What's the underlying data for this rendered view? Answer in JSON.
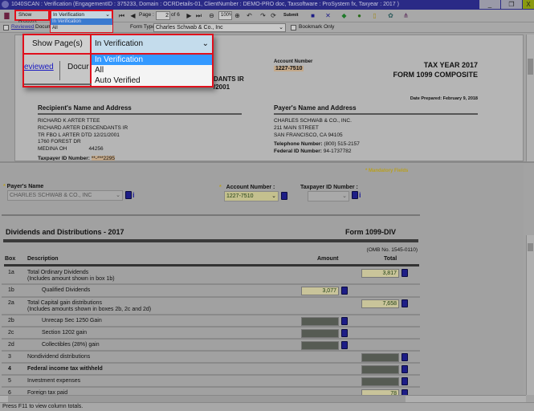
{
  "window": {
    "title": "1040SCAN : Verification (EngagementID : 375233, Domain : OCRDetails-01, ClientNumber : DEMO-PRO doc, Taxsoftware : ProSystem fx, Taxyear : 2017 )",
    "minimize": "_",
    "restore": "❐",
    "close": "X"
  },
  "toolbar": {
    "show_pages_label": "Show Page(s)",
    "show_pages_value": "In Verification",
    "show_pages_options": [
      "In Verification",
      "All",
      "Auto Verified"
    ],
    "page_label": "Page :",
    "page_value": "2",
    "page_of": "of 6",
    "zoom_value": "100%",
    "submit_label": "Submit"
  },
  "toolbar2": {
    "reviewed_link": "Reviewed",
    "document_tab": "Docum",
    "form_type_label": "Form Type",
    "form_type_value": "Charles Schwab & Co., Inc",
    "bookmark_label": "Bookmark Only"
  },
  "callout": {
    "show_pages_label": "Show Page(s)",
    "value": "In Verification",
    "options": [
      "In Verification",
      "All",
      "Auto Verified"
    ],
    "reviewed_link": "eviewed",
    "document_tab": "Docur"
  },
  "document": {
    "account_number_label": "Account Number",
    "account_number": "1227-7510",
    "tax_year": "TAX YEAR 2017",
    "form_title": "FORM 1099 COMPOSITE",
    "date_prepared_label": "Date Prepared:",
    "date_prepared": "February 9, 2018",
    "hidden_1": "DANTS IR",
    "hidden_2": "/2001",
    "recipient_heading": "Recipient's Name and Address",
    "recipient_lines": [
      "RICHARD K ARTER TTEE",
      "RICHARD ARTER DESCENDANTS IR",
      "TR FBO L ARTER DTD 12/21/2001",
      "1760 FOREST DR",
      "MEDINA OH"
    ],
    "recipient_zip": "44256",
    "taxpayer_id_label": "Taxpayer ID Number:",
    "taxpayer_id": "**-***2295",
    "payer_heading": "Payer's Name and Address",
    "payer_lines": [
      "CHARLES SCHWAB & CO., INC.",
      "211 MAIN STREET",
      "SAN FRANCISCO, CA 94105"
    ],
    "telephone_label": "Telephone Number:",
    "telephone": "(800) 515-2157",
    "federal_id_label": "Federal ID Number:",
    "federal_id": "94-1737782"
  },
  "form": {
    "mandatory": "* Mandatory Fields",
    "payer_name_label": "Payer's Name",
    "payer_name_value": "CHARLES SCHWAB & CO., INC",
    "account_number_label": "Account Number :",
    "account_number_value": "1227-7510",
    "taxpayer_id_label": "Taxpayer ID Number :",
    "taxpayer_id_value": "",
    "info": "i",
    "section_title": "Dividends and Distributions - 2017",
    "form_name": "Form 1099-DIV",
    "omb": "(OMB No. 1545-0110)",
    "col_box": "Box",
    "col_description": "Description",
    "col_amount": "Amount",
    "col_total": "Total",
    "rows": [
      {
        "box": "1a",
        "desc": "Total Ordinary Dividends",
        "desc2": "(Includes amount shown in box 1b)",
        "col": "total",
        "value": "3,817",
        "filled": true
      },
      {
        "box": "1b",
        "desc": "Qualified Dividends",
        "indent": true,
        "col": "amount",
        "value": "3,077",
        "filled": true
      },
      {
        "box": "2a",
        "desc": "Total Capital gain distributions",
        "desc2": "(Includes amounts shown in boxes 2b, 2c and 2d)",
        "col": "total",
        "value": "7,658",
        "filled": true
      },
      {
        "box": "2b",
        "desc": "Unrecap Sec 1250 Gain",
        "indent": true,
        "col": "amount",
        "value": "",
        "filled": false
      },
      {
        "box": "2c",
        "desc": "Section 1202 gain",
        "indent": true,
        "col": "amount",
        "value": "",
        "filled": false
      },
      {
        "box": "2d",
        "desc": "Collectibles (28%) gain",
        "indent": true,
        "col": "amount",
        "value": "",
        "filled": false
      },
      {
        "box": "3",
        "desc": "Nondividend distributions",
        "col": "total",
        "value": "",
        "filled": false
      },
      {
        "box": "4",
        "desc": "Federal income tax withheld",
        "bold": true,
        "col": "total",
        "value": "",
        "filled": false
      },
      {
        "box": "5",
        "desc": "Investment expenses",
        "col": "total",
        "value": "",
        "filled": false
      },
      {
        "box": "6",
        "desc": "Foreign tax paid",
        "col": "total",
        "value": "78",
        "filled": true
      }
    ]
  },
  "status": {
    "text": "Press F11 to view column totals."
  },
  "colors": {
    "titlebar": "#2a2a86",
    "highlight": "#e0101c",
    "selected_option": "#3399ff",
    "mandatory": "#b8a020",
    "input_filled": "#c9c49a"
  }
}
